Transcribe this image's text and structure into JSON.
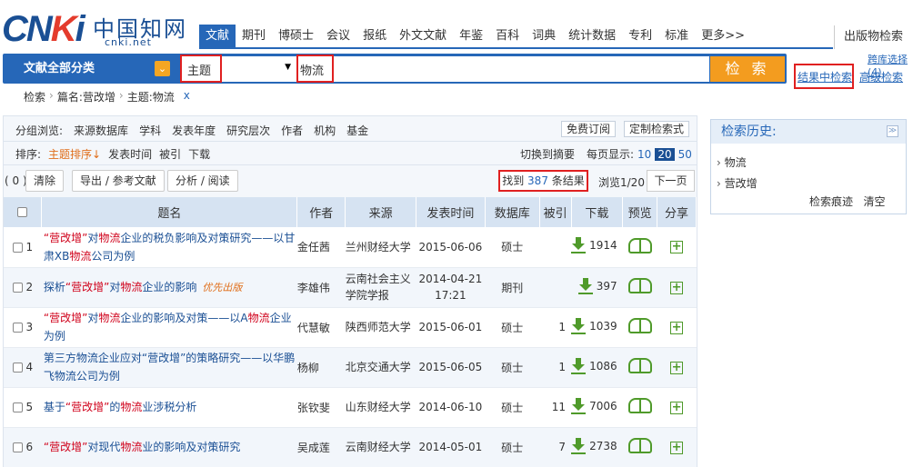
{
  "logo": {
    "brand_c": "C",
    "brand_n": "N",
    "brand_k": "K",
    "brand_i": "i",
    "cn": "中国知网",
    "url": "cnki.net"
  },
  "nav": {
    "tabs": [
      "文献",
      "期刊",
      "博硕士",
      "会议",
      "报纸",
      "外文文献",
      "年鉴",
      "百科",
      "词典",
      "统计数据",
      "专利",
      "标准",
      "更多>>"
    ],
    "active": 0,
    "publish": "出版物检索"
  },
  "search": {
    "category_label": "文献全部分类",
    "field": "主题",
    "keyword": "物流",
    "button": "检 索",
    "kw_select": "跨库选择(4)",
    "in_result": "结果中检索",
    "advanced": "高级检索"
  },
  "breadcrumb": {
    "items": [
      "检索",
      "篇名:营改增",
      "主题:物流"
    ],
    "x": "x"
  },
  "group": {
    "label": "分组浏览:",
    "items": [
      "来源数据库",
      "学科",
      "发表年度",
      "研究层次",
      "作者",
      "机构",
      "基金"
    ],
    "subscribe": "免费订阅",
    "custom": "定制检索式"
  },
  "sort": {
    "label": "排序:",
    "items": [
      "主题排序↓",
      "发表时间",
      "被引",
      "下载"
    ],
    "switch": "切换到摘要",
    "per_page_label": "每页显示:",
    "per_page": [
      "10",
      "20",
      "50"
    ],
    "per_page_active": "20"
  },
  "toolbar": {
    "count": "( 0 )",
    "clear": "清除",
    "export": "导出 / 参考文献",
    "analyze": "分析 / 阅读",
    "found_pre": "找到 ",
    "found_num": "387",
    "found_post": " 条结果",
    "browse": "浏览1/20",
    "next": "下一页"
  },
  "table": {
    "headers": [
      "题名",
      "作者",
      "来源",
      "发表时间",
      "数据库",
      "被引",
      "下载",
      "预览",
      "分享"
    ],
    "rows": [
      {
        "n": "1",
        "title_parts": [
          [
            "“营改增”",
            "h"
          ],
          [
            "对",
            ""
          ],
          [
            "物流",
            "h"
          ],
          [
            "企业的税负影响及对策研究——以甘肃XB",
            ""
          ],
          [
            "物流",
            "h"
          ],
          [
            "公司为例",
            ""
          ]
        ],
        "first": "",
        "author": "金任茜",
        "source": "兰州财经大学",
        "date": "2015-06-06",
        "db": "硕士",
        "cited": "",
        "dl": "1914"
      },
      {
        "n": "2",
        "title_parts": [
          [
            "探析",
            ""
          ],
          [
            "“营改增”",
            "h"
          ],
          [
            "对",
            ""
          ],
          [
            "物流",
            "h"
          ],
          [
            "企业的影响",
            ""
          ]
        ],
        "first": "优先出版",
        "author": "李雄伟",
        "source": "云南社会主义学院学报",
        "date": "2014-04-21 17:21",
        "db": "期刊",
        "cited": "",
        "dl": "397"
      },
      {
        "n": "3",
        "title_parts": [
          [
            "“营改增”",
            "h"
          ],
          [
            "对",
            ""
          ],
          [
            "物流",
            "h"
          ],
          [
            "企业的影响及对策——以A",
            ""
          ],
          [
            "物流",
            "h"
          ],
          [
            "企业为例",
            ""
          ]
        ],
        "first": "",
        "author": "代慧敏",
        "source": "陕西师范大学",
        "date": "2015-06-01",
        "db": "硕士",
        "cited": "1",
        "dl": "1039"
      },
      {
        "n": "4",
        "title_parts": [
          [
            "第三方物流企业应对“营改增”的策略研究——以华鹏飞物流公司为例",
            ""
          ]
        ],
        "first": "",
        "author": "杨柳",
        "source": "北京交通大学",
        "date": "2015-06-05",
        "db": "硕士",
        "cited": "1",
        "dl": "1086"
      },
      {
        "n": "5",
        "title_parts": [
          [
            "基于",
            ""
          ],
          [
            "“营改增”",
            "h"
          ],
          [
            "的",
            ""
          ],
          [
            "物流",
            "h"
          ],
          [
            "业涉税分析",
            ""
          ]
        ],
        "first": "",
        "author": "张钦斐",
        "source": "山东财经大学",
        "date": "2014-06-10",
        "db": "硕士",
        "cited": "11",
        "dl": "7006"
      },
      {
        "n": "6",
        "title_parts": [
          [
            "“营改增”",
            "h"
          ],
          [
            "对现代",
            ""
          ],
          [
            "物流",
            "h"
          ],
          [
            "业的影响及对策研究",
            ""
          ]
        ],
        "first": "",
        "author": "吴成莲",
        "source": "云南财经大学",
        "date": "2014-05-01",
        "db": "硕士",
        "cited": "7",
        "dl": "2738"
      }
    ]
  },
  "history": {
    "title": "检索历史:",
    "items": [
      "物流",
      "营改增"
    ],
    "trace": "检索痕迹",
    "clear": "清空"
  }
}
